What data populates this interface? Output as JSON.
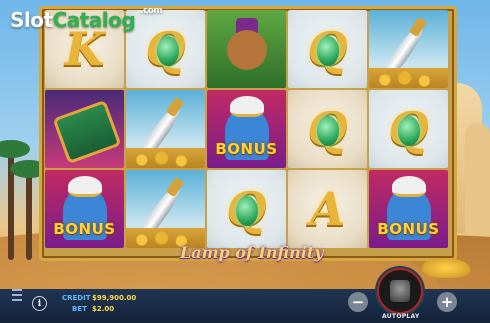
{
  "watermark": {
    "part1": "Slot",
    "part2": "Catalog",
    "suffix": ".com"
  },
  "game": {
    "title": "Lamp of Infinity"
  },
  "reels": [
    [
      "K",
      "carpet",
      "genie_bonus"
    ],
    [
      "Q",
      "sword",
      "sword"
    ],
    [
      "monkey",
      "genie_bonus",
      "Q"
    ],
    [
      "Q",
      "Q",
      "A"
    ],
    [
      "sword",
      "Q",
      "genie_bonus"
    ]
  ],
  "symbol_labels": {
    "bonus": "BONUS"
  },
  "controls": {
    "credit_label": "CREDIT",
    "credit_value": "$99,900.00",
    "bet_label": "BET",
    "bet_value": "$2.00",
    "minus": "−",
    "plus": "+",
    "info": "i",
    "autoplay_label": "AUTOPLAY"
  },
  "colors": {
    "frame": "#d8a840",
    "bar": "#14223a",
    "label": "#5fb8ff",
    "value": "#ffd94a"
  }
}
